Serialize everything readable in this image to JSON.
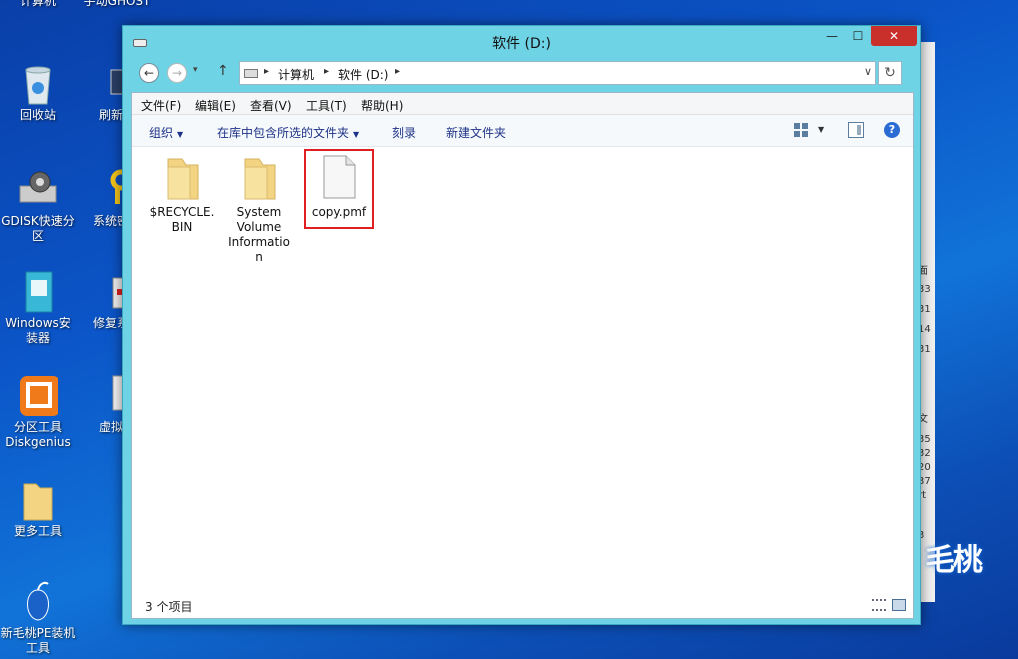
{
  "desktop": {
    "icons": [
      {
        "label": "计算机"
      },
      {
        "label": "手动GHOST"
      },
      {
        "label": "回收站"
      },
      {
        "label": "刷新桌"
      },
      {
        "label": "GDISK快速分区"
      },
      {
        "label": "系统密码"
      },
      {
        "label": "Windows安装器"
      },
      {
        "label": "修复系统"
      },
      {
        "label": "分区工具Diskgenius"
      },
      {
        "label": "虚拟光"
      },
      {
        "label": "更多工具"
      },
      {
        "label": "新毛桃PE装机工具"
      }
    ],
    "brand": "毛桃",
    "bg_window_fragments": [
      "面",
      "33",
      "31",
      "14",
      "31",
      "文",
      "35",
      "32",
      "20",
      "37",
      "rt",
      "3"
    ]
  },
  "window": {
    "title": "软件 (D:)",
    "buttons": {
      "minimize": "—",
      "maximize": "☐",
      "close": "✕"
    },
    "nav": {
      "back": "←",
      "forward": "→",
      "history": "▾",
      "up": "↑",
      "refresh": "↻",
      "dropdown": "∨"
    },
    "breadcrumb": [
      "计算机",
      "软件 (D:)"
    ],
    "crumb_sep": "▸",
    "menu": [
      "文件(F)",
      "编辑(E)",
      "查看(V)",
      "工具(T)",
      "帮助(H)"
    ],
    "toolbar": {
      "organize": "组织",
      "include_in_library": "在库中包含所选的文件夹",
      "burn": "刻录",
      "new_folder": "新建文件夹",
      "help": "?"
    },
    "files": [
      {
        "name": "$RECYCLE.BIN",
        "line1": "$RECYCLE.",
        "line2": "BIN",
        "type": "folder"
      },
      {
        "name": "System Volume Information",
        "line1": "System",
        "line2": "Volume",
        "line3": "Informatio",
        "line4": "n",
        "type": "folder"
      },
      {
        "name": "copy.pmf",
        "type": "file",
        "highlighted": true
      }
    ],
    "status": "3 个项目"
  },
  "colors": {
    "window_frame": "#6fd3e6",
    "close_button": "#c9302c",
    "highlight": "#e02020",
    "folder": "#f3d483",
    "link_text": "#1e3287"
  }
}
